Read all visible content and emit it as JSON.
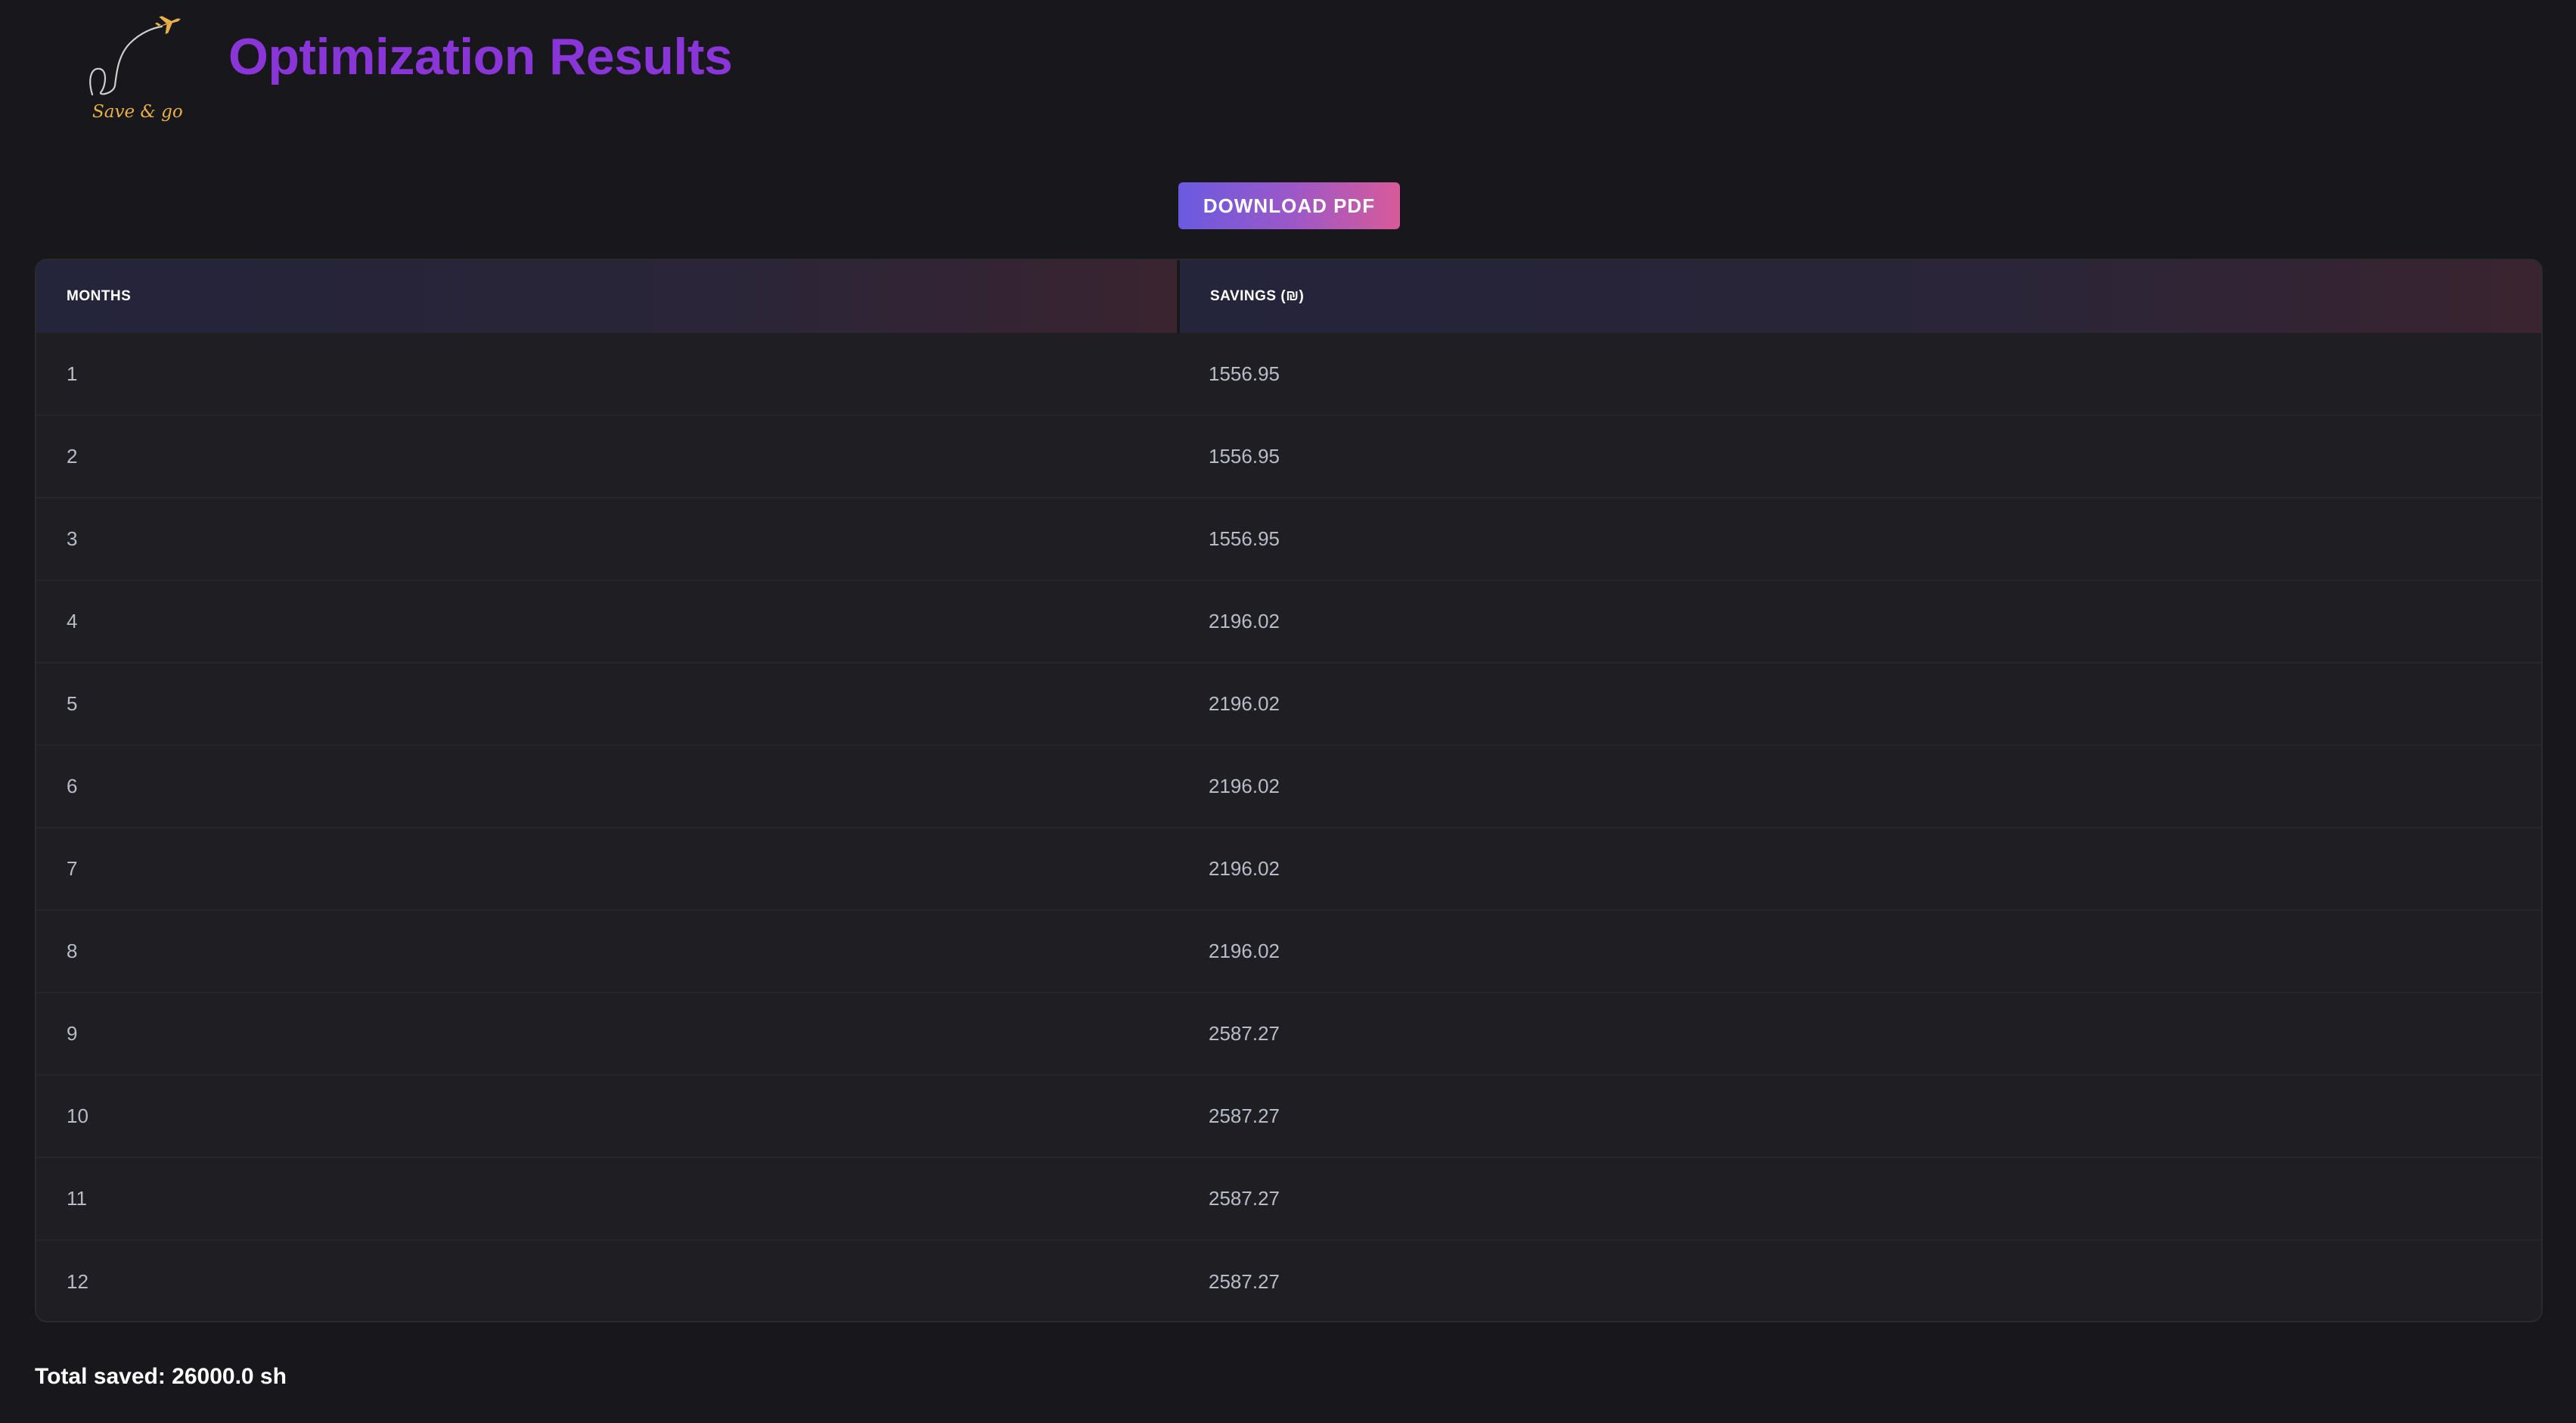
{
  "header": {
    "logo_text": "Save & go",
    "title": "Optimization Results"
  },
  "actions": {
    "download_label": "DOWNLOAD PDF"
  },
  "table": {
    "columns": [
      "MONTHS",
      "SAVINGS (₪)"
    ],
    "rows": [
      {
        "month": "1",
        "savings": "1556.95"
      },
      {
        "month": "2",
        "savings": "1556.95"
      },
      {
        "month": "3",
        "savings": "1556.95"
      },
      {
        "month": "4",
        "savings": "2196.02"
      },
      {
        "month": "5",
        "savings": "2196.02"
      },
      {
        "month": "6",
        "savings": "2196.02"
      },
      {
        "month": "7",
        "savings": "2196.02"
      },
      {
        "month": "8",
        "savings": "2196.02"
      },
      {
        "month": "9",
        "savings": "2587.27"
      },
      {
        "month": "10",
        "savings": "2587.27"
      },
      {
        "month": "11",
        "savings": "2587.27"
      },
      {
        "month": "12",
        "savings": "2587.27"
      }
    ]
  },
  "summary": {
    "total_text": "Total saved: 26000.0 sh"
  },
  "colors": {
    "background": "#17171c",
    "title": "#8a35d8",
    "logo_accent": "#e9b04a",
    "button_gradient_start": "#6a5ae0",
    "button_gradient_end": "#d85a9a"
  },
  "icons": {
    "logo": "airplane-path-logo-icon"
  }
}
